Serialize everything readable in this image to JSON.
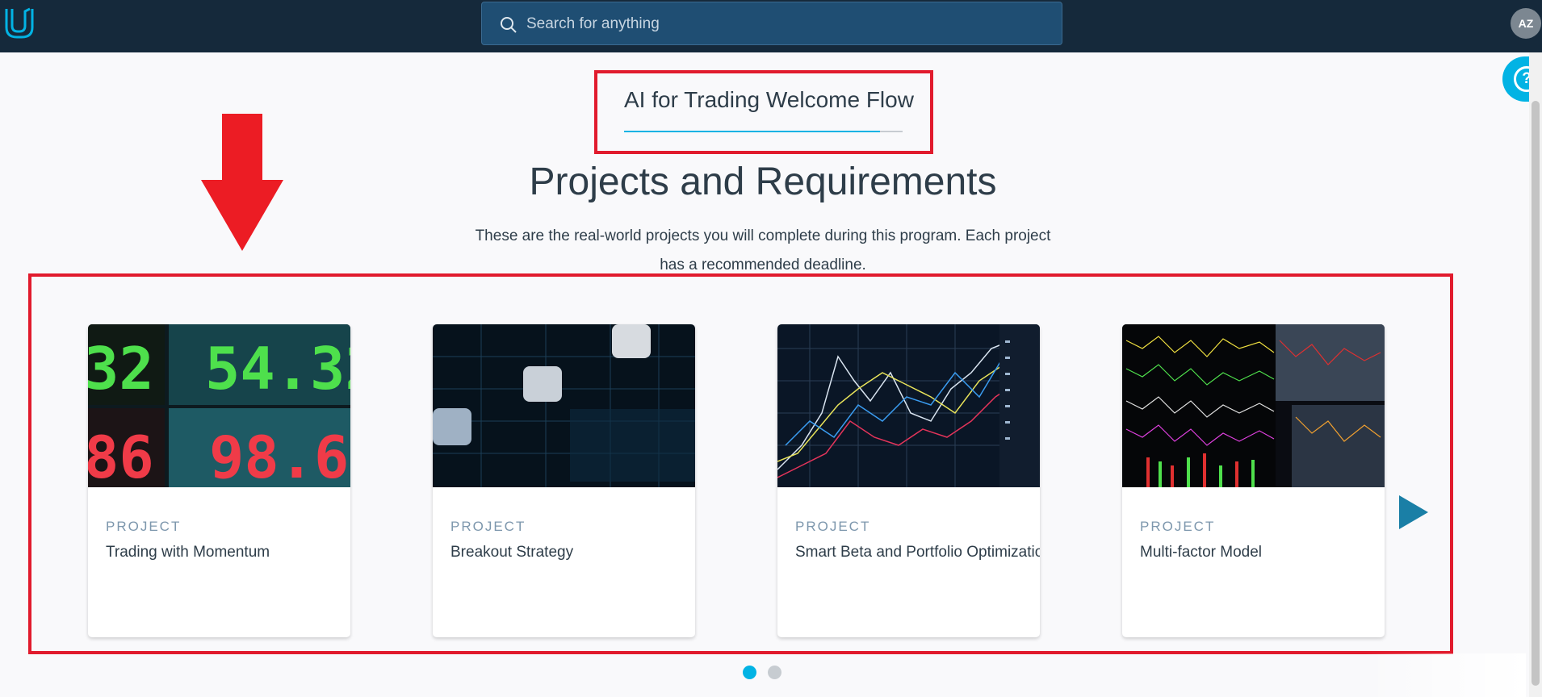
{
  "topbar": {
    "search_placeholder": "Search for anything",
    "avatar_initials": "AZ"
  },
  "flow": {
    "title": "AI for Trading Welcome Flow",
    "progress": 0.92
  },
  "section": {
    "title": "Projects and Requirements",
    "description": "These are the real-world projects you will complete during this program. Each project has a recommended deadline."
  },
  "cards": [
    {
      "kicker": "PROJECT",
      "title": "Trading with Momentum",
      "image": "stock-ticker-board"
    },
    {
      "kicker": "PROJECT",
      "title": "Breakout Strategy",
      "image": "abstract-grid-lights"
    },
    {
      "kicker": "PROJECT",
      "title": "Smart Beta and Portfolio Optimization",
      "image": "line-chart-display"
    },
    {
      "kicker": "PROJECT",
      "title": "Multi-factor Model",
      "image": "trading-monitors"
    }
  ],
  "carousel": {
    "pages": 2,
    "active_page": 1
  },
  "colors": {
    "accent": "#02b3e4",
    "annotation": "#e11b2d",
    "topbar": "#15293b"
  }
}
